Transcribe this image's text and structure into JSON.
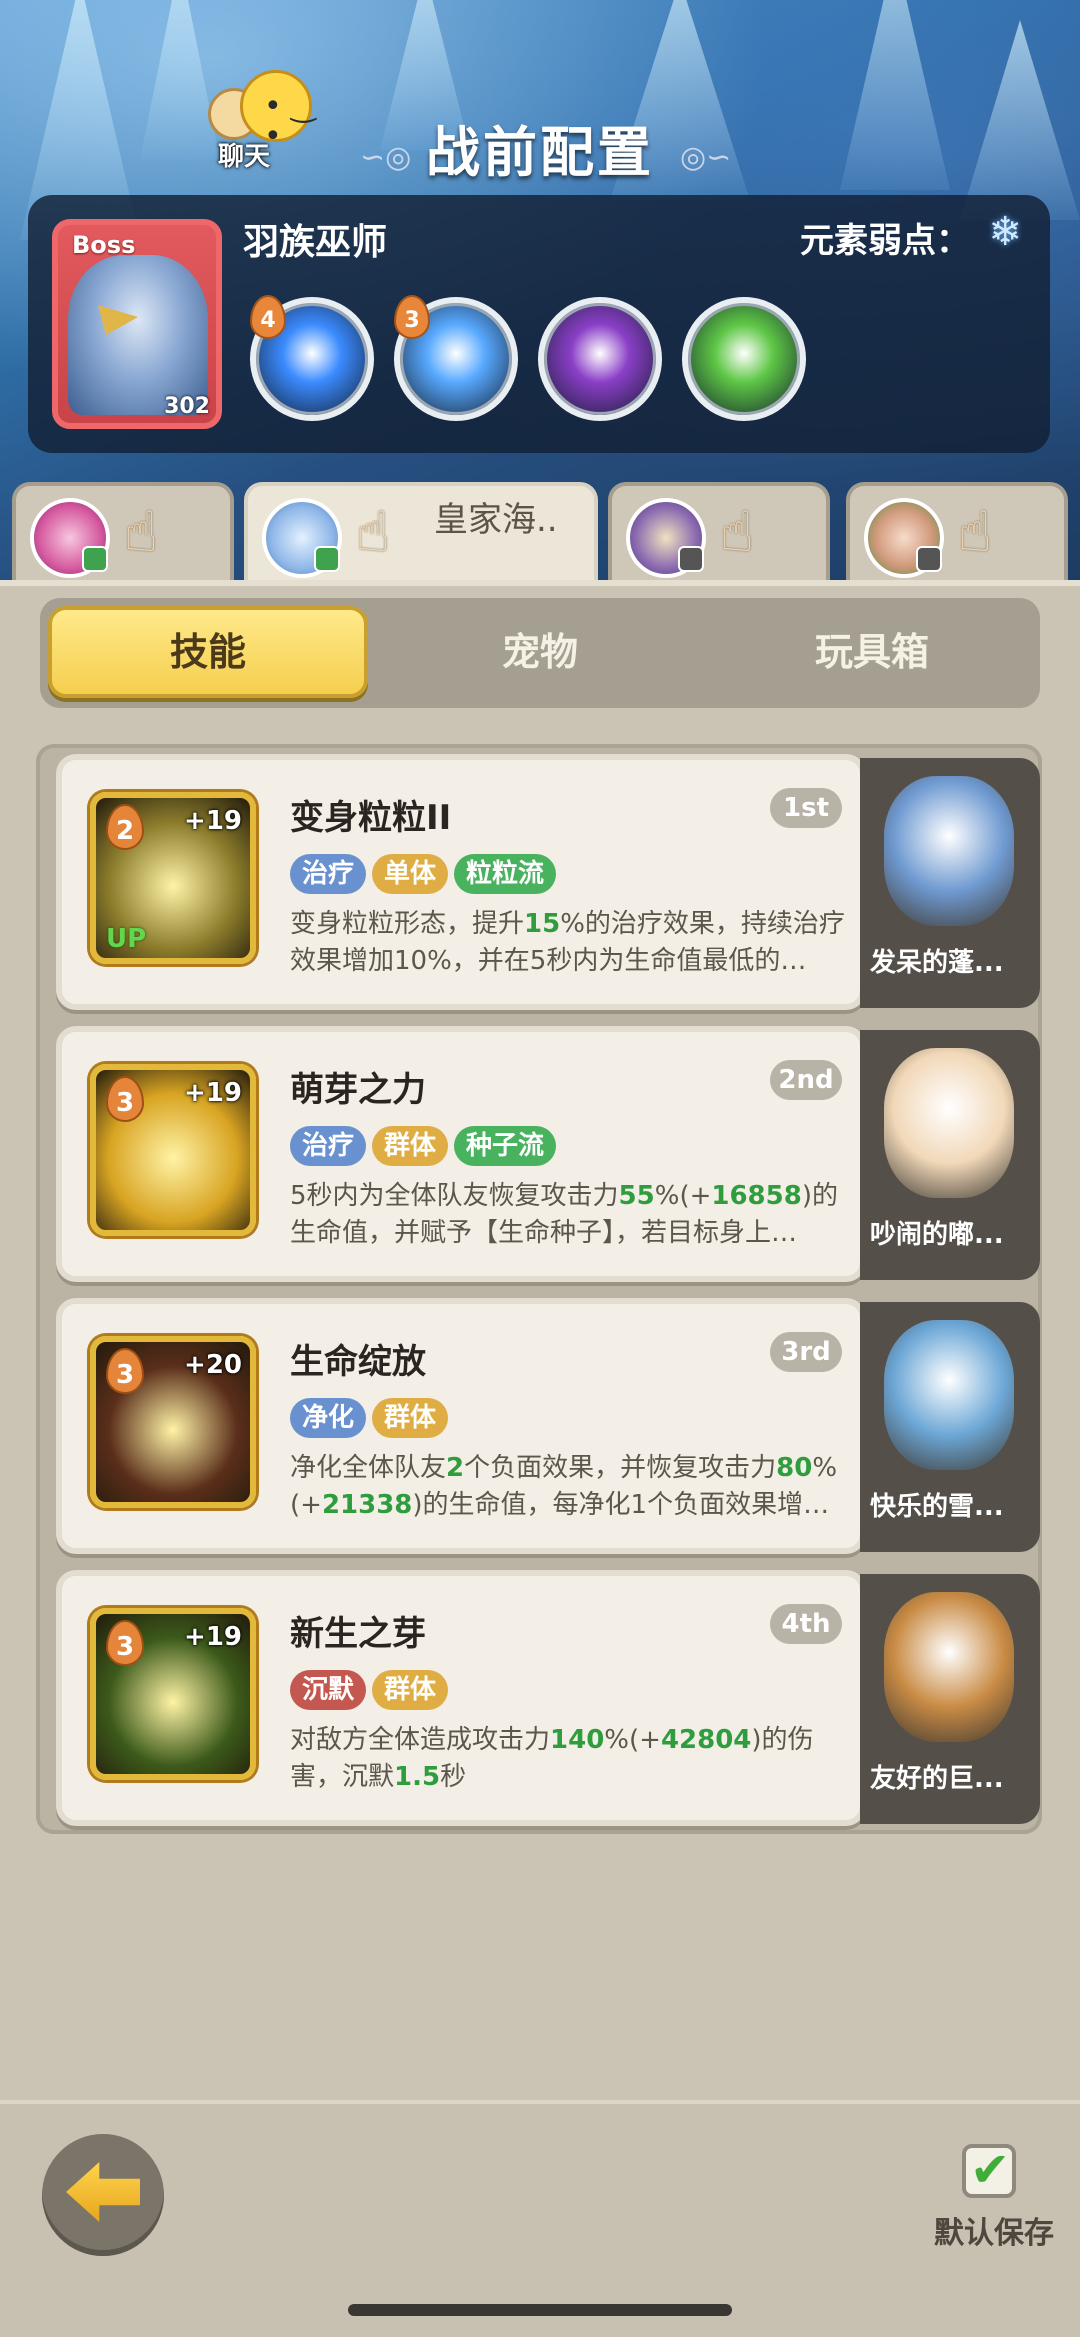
{
  "header": {
    "title": "战前配置",
    "chat_label": "聊天"
  },
  "boss": {
    "tag": "Boss",
    "level": "302",
    "name": "羽族巫师",
    "weakness_label": "元素弱点：",
    "weakness_icon": "snowflake-icon",
    "skills": [
      {
        "badge": "4",
        "color": "#3b8bff"
      },
      {
        "badge": "3",
        "color": "#58a9ff"
      },
      {
        "badge": "",
        "color": "#8a3fc7"
      },
      {
        "badge": "",
        "color": "#5ec746"
      }
    ]
  },
  "team_tabs": [
    {
      "name": "",
      "active": false
    },
    {
      "name": "皇家海..",
      "active": true
    },
    {
      "name": "",
      "active": false
    },
    {
      "name": "",
      "active": false
    }
  ],
  "segments": {
    "items": [
      "技能",
      "宠物",
      "玩具箱"
    ],
    "active": "技能"
  },
  "skills": [
    {
      "level": "2",
      "bonus": "+19",
      "up": "UP",
      "title": "变身粒粒II",
      "rank": "1st",
      "tags": [
        {
          "text": "治疗",
          "color": "blue"
        },
        {
          "text": "单体",
          "color": "gold"
        },
        {
          "text": "粒粒流",
          "color": "green"
        }
      ],
      "desc": [
        {
          "t": "变身粒粒形态，提升"
        },
        {
          "t": "15",
          "hl": true
        },
        {
          "t": "%的治疗效果，持续治疗效果增加10%，并在5秒内为生命值最低的…"
        }
      ],
      "pet_name": "发呆的蓬...",
      "icon_color": "#8a7b2b"
    },
    {
      "level": "3",
      "bonus": "+19",
      "up": "",
      "title": "萌芽之力",
      "rank": "2nd",
      "tags": [
        {
          "text": "治疗",
          "color": "blue"
        },
        {
          "text": "群体",
          "color": "gold"
        },
        {
          "text": "种子流",
          "color": "green"
        }
      ],
      "desc": [
        {
          "t": "5秒内为全体队友恢复攻击力"
        },
        {
          "t": "55",
          "hl": true
        },
        {
          "t": "%(+"
        },
        {
          "t": "16858",
          "hl": true
        },
        {
          "t": ")的生命值，并赋予【生命种子】，若目标身上…"
        }
      ],
      "pet_name": "吵闹的嘟...",
      "icon_color": "#d8a422"
    },
    {
      "level": "3",
      "bonus": "+20",
      "up": "",
      "title": "生命绽放",
      "rank": "3rd",
      "tags": [
        {
          "text": "净化",
          "color": "blue"
        },
        {
          "text": "群体",
          "color": "gold"
        }
      ],
      "desc": [
        {
          "t": "净化全体队友"
        },
        {
          "t": "2",
          "hl": true
        },
        {
          "t": "个负面效果，并恢复攻击力"
        },
        {
          "t": "80",
          "hl": true
        },
        {
          "t": "%(+"
        },
        {
          "t": "21338",
          "hl": true
        },
        {
          "t": ")的生命值，每净化1个负面效果增…"
        }
      ],
      "pet_name": "快乐的雪...",
      "icon_color": "#5a2e1a"
    },
    {
      "level": "3",
      "bonus": "+19",
      "up": "",
      "title": "新生之芽",
      "rank": "4th",
      "tags": [
        {
          "text": "沉默",
          "color": "red"
        },
        {
          "text": "群体",
          "color": "gold"
        }
      ],
      "desc": [
        {
          "t": "对敌方全体造成攻击力"
        },
        {
          "t": "140",
          "hl": true
        },
        {
          "t": "%(+"
        },
        {
          "t": "42804",
          "hl": true
        },
        {
          "t": ")的伤害，沉默"
        },
        {
          "t": "1.5",
          "hl": true
        },
        {
          "t": "秒"
        }
      ],
      "pet_name": "友好的巨...",
      "icon_color": "#3c5a1a"
    }
  ],
  "footer": {
    "save_label": "默认保存",
    "save_checked": true
  }
}
